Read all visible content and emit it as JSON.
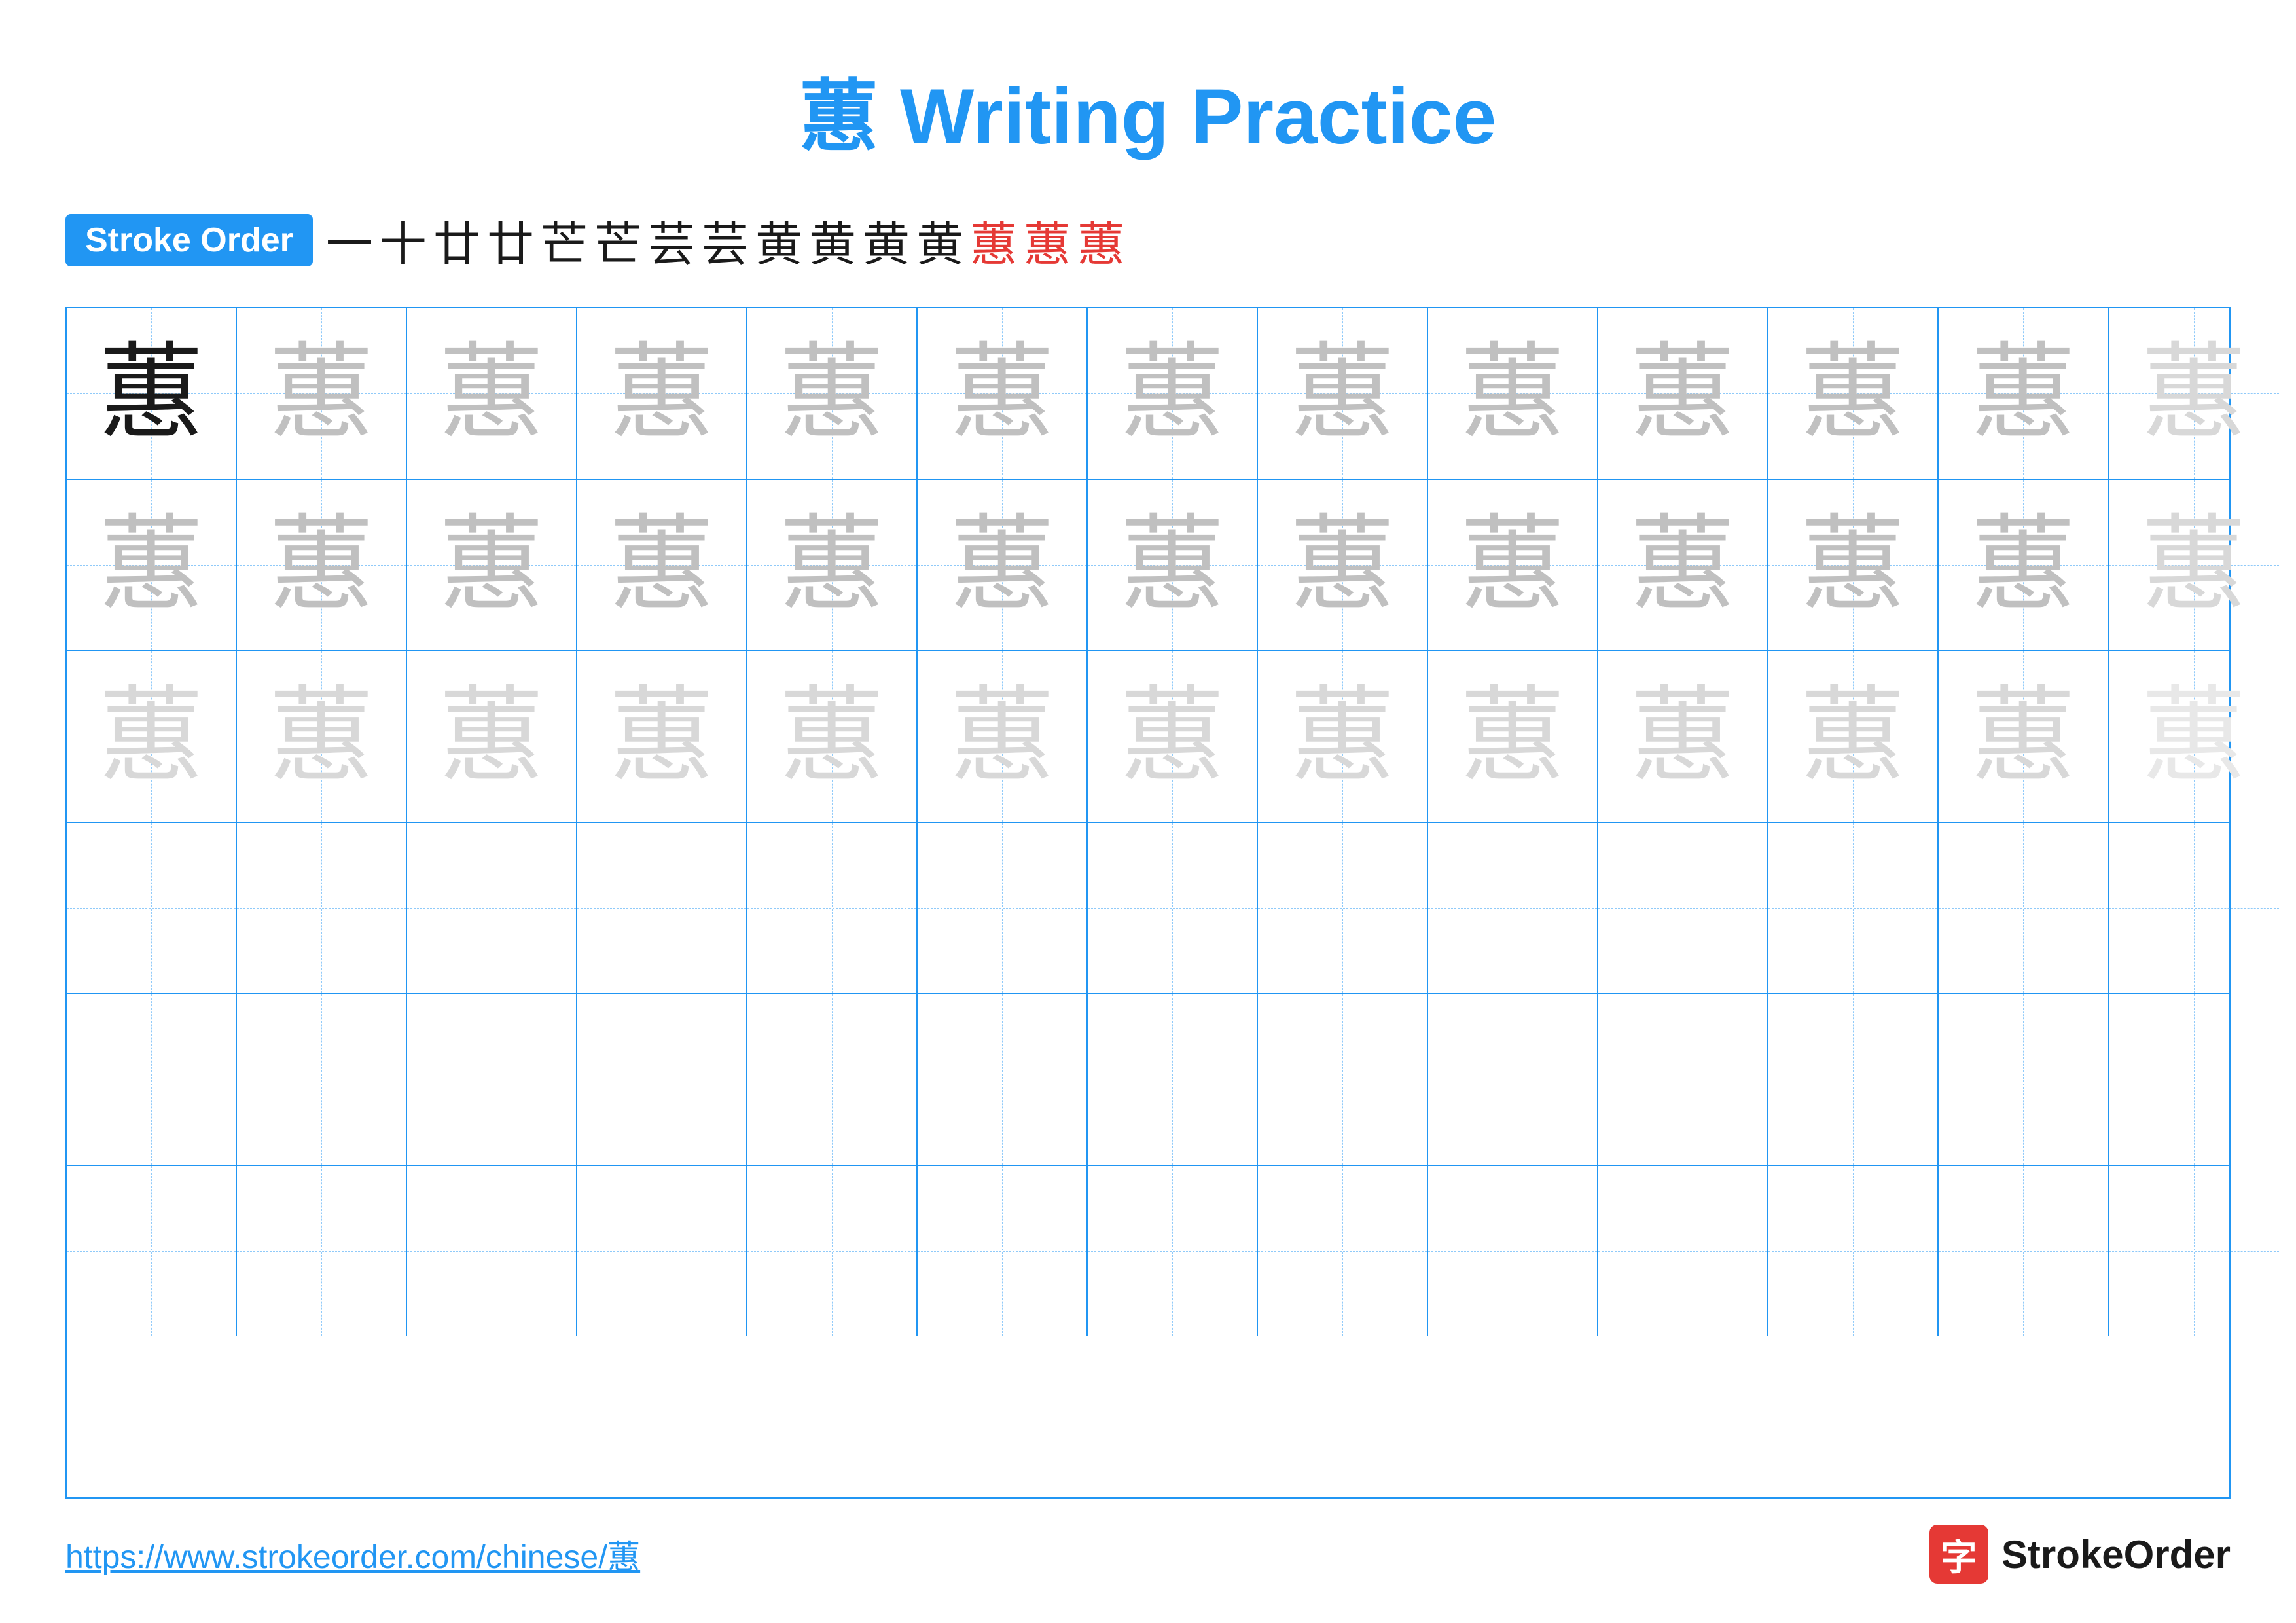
{
  "title": {
    "char": "蕙",
    "label": "Writing Practice",
    "full": "蕙 Writing Practice"
  },
  "stroke_order": {
    "badge_label": "Stroke Order",
    "strokes": [
      "一",
      "十",
      "廿",
      "廿",
      "芒",
      "芒",
      "芸",
      "芸",
      "黄",
      "黄",
      "黄",
      "黄",
      "蕙",
      "蕙",
      "蕙"
    ],
    "red_indices": [
      12,
      13,
      14
    ]
  },
  "grid": {
    "rows": 6,
    "cols": 13,
    "char": "蕙",
    "row_shades": [
      "dark",
      "medium",
      "light",
      "empty",
      "empty",
      "empty"
    ]
  },
  "footer": {
    "url": "https://www.strokeorder.com/chinese/蕙",
    "logo_icon": "字",
    "logo_text": "StrokeOrder"
  }
}
